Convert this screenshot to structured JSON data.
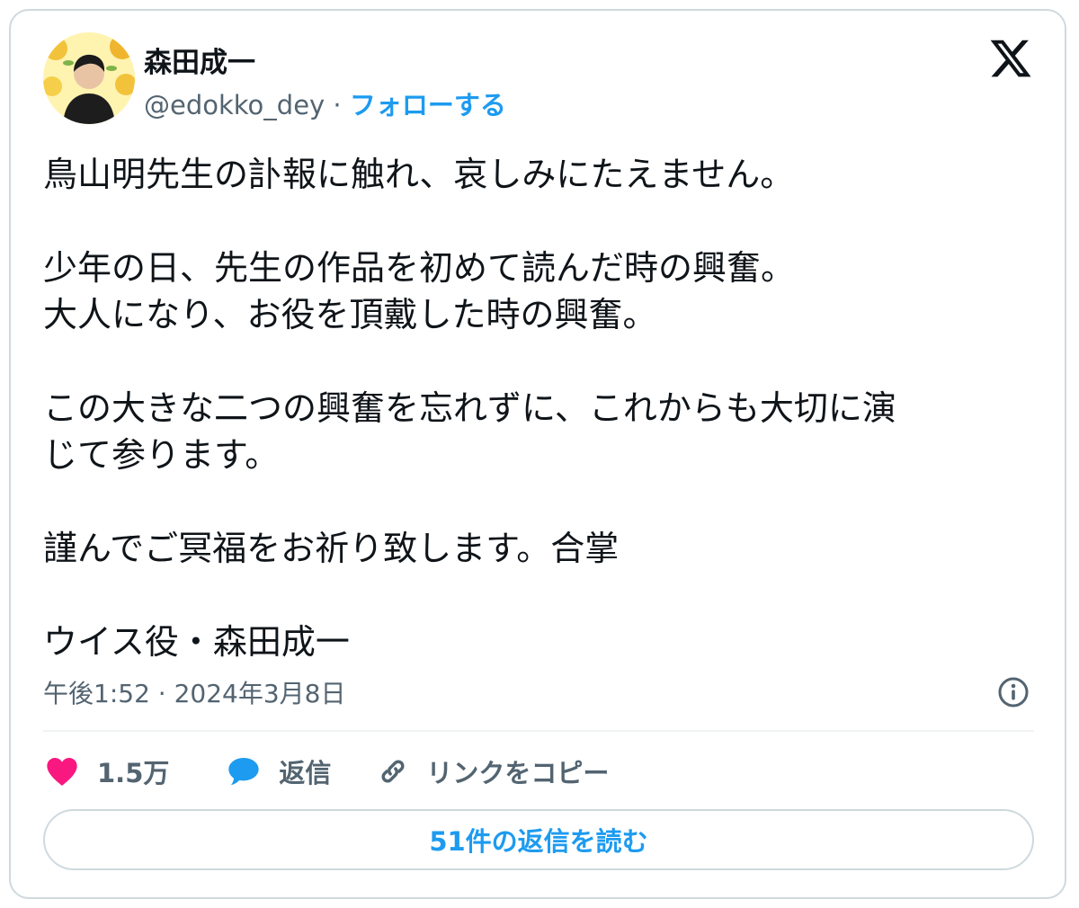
{
  "author": {
    "name": "森田成一",
    "handle": "@edokko_dey",
    "separator": " · ",
    "follow_label": "フォローする"
  },
  "tweet": {
    "paragraphs": [
      "鳥山明先生の訃報に触れ、哀しみにたえません。",
      "少年の日、先生の作品を初めて読んだ時の興奮。\n大人になり、お役を頂戴した時の興奮。",
      "この大きな二つの興奮を忘れずに、これからも大切に演\nじて参ります。",
      "謹んでご冥福をお祈り致します。合掌",
      "ウイス役・森田成一"
    ],
    "timestamp": "午後1:52 · 2024年3月8日"
  },
  "actions": {
    "like_count": "1.5万",
    "reply_label": "返信",
    "copy_link_label": "リンクをコピー"
  },
  "read_replies_label": "51件の返信を読む",
  "icons": {
    "brand": "x-logo-icon",
    "info": "info-icon",
    "like": "heart-icon",
    "reply": "speech-bubble-icon",
    "copy": "link-icon"
  },
  "colors": {
    "accent": "#1d9bf0",
    "like": "#f91880",
    "text": "#0f1419",
    "secondary": "#536471",
    "border": "#cfd9de"
  }
}
